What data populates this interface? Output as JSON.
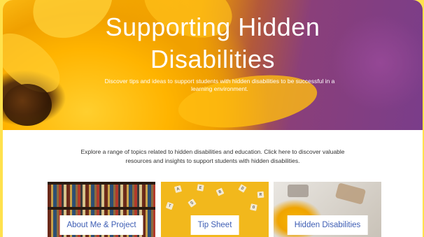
{
  "hero": {
    "title_line1": "Supporting Hidden",
    "title_line2": "Disabilities",
    "subtitle": "Discover tips and ideas to support students with hidden disabilities to be successful in a learning environment."
  },
  "intro": {
    "text": "Explore a range of topics related to hidden disabilities and education. Click here to discover valuable resources and insights to support students with hidden disabilities."
  },
  "cards": [
    {
      "label": "About Me & Project"
    },
    {
      "label": "Tip Sheet"
    },
    {
      "label": "Hidden Disabilities"
    }
  ],
  "colors": {
    "page_background": "#ffe14d",
    "card_label_text": "#3d5db4",
    "intro_text": "#333333"
  }
}
